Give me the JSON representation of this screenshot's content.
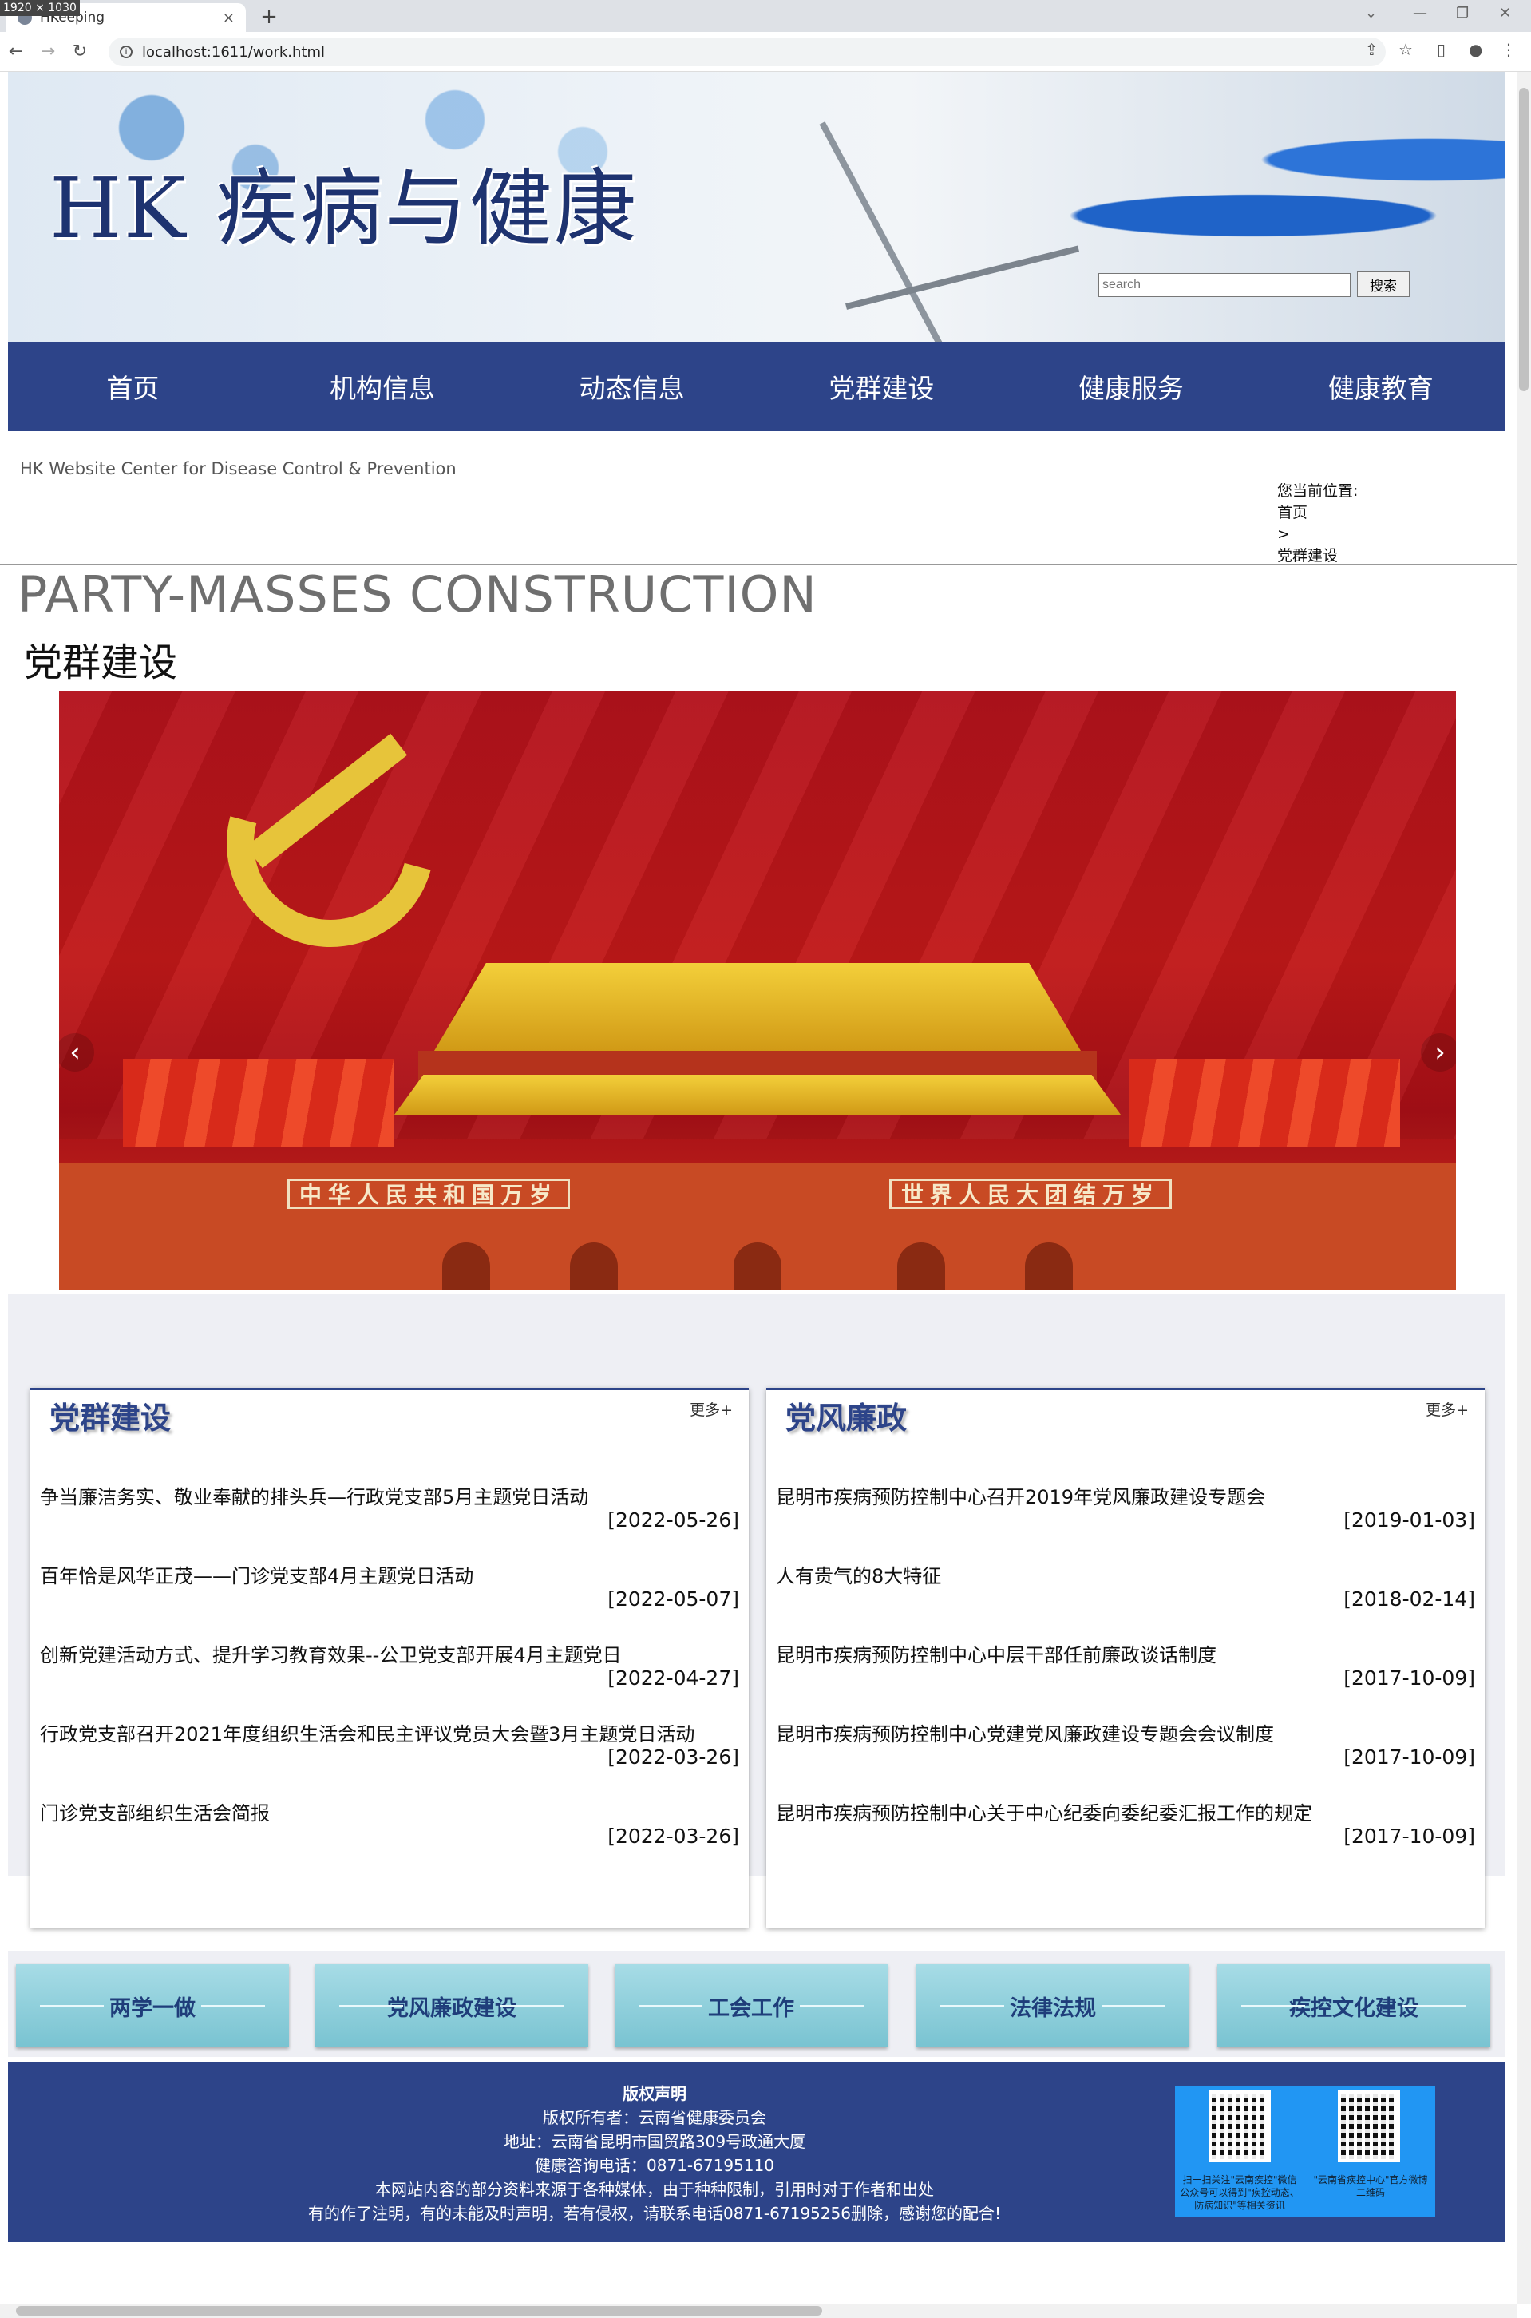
{
  "browser": {
    "dim_badge": "1920 × 1030",
    "tab_title": "HKeeping",
    "url": "localhost:1611/work.html"
  },
  "header": {
    "site_title": "HK 疾病与健康",
    "search_placeholder": "search",
    "search_button": "搜索"
  },
  "nav": [
    "首页",
    "机构信息",
    "动态信息",
    "党群建设",
    "健康服务",
    "健康教育"
  ],
  "subheader": {
    "en_center": "HK Website Center for Disease Control & Prevention",
    "breadcrumb_label": "您当前位置:",
    "breadcrumb_home": "首页",
    "breadcrumb_sep": ">",
    "breadcrumb_current": "党群建设"
  },
  "page": {
    "en_title": "PARTY-MASSES CONSTRUCTION",
    "zh_title": "党群建设"
  },
  "carousel": {
    "slogan_left": "中华人民共和国万岁",
    "slogan_right": "世界人民大团结万岁",
    "prev": "‹",
    "next": "›",
    "dots": 5,
    "active_dot": 1
  },
  "panels": [
    {
      "title": "党群建设",
      "more": "更多+",
      "items": [
        {
          "title": "争当廉洁务实、敬业奉献的排头兵—行政党支部5月主题党日活动",
          "date": "[2022-05-26]"
        },
        {
          "title": "百年恰是风华正茂——门诊党支部4月主题党日活动",
          "date": "[2022-05-07]"
        },
        {
          "title": "创新党建活动方式、提升学习教育效果--公卫党支部开展4月主题党日",
          "date": "[2022-04-27]"
        },
        {
          "title": "行政党支部召开2021年度组织生活会和民主评议党员大会暨3月主题党日活动",
          "date": "[2022-03-26]"
        },
        {
          "title": "门诊党支部组织生活会简报",
          "date": "[2022-03-26]"
        }
      ]
    },
    {
      "title": "党风廉政",
      "more": "更多+",
      "items": [
        {
          "title": "昆明市疾病预防控制中心召开2019年党风廉政建设专题会",
          "date": "[2019-01-03]"
        },
        {
          "title": "人有贵气的8大特征",
          "date": "[2018-02-14]"
        },
        {
          "title": "昆明市疾病预防控制中心中层干部任前廉政谈话制度",
          "date": "[2017-10-09]"
        },
        {
          "title": "昆明市疾病预防控制中心党建党风廉政建设专题会会议制度",
          "date": "[2017-10-09]"
        },
        {
          "title": "昆明市疾病预防控制中心关于中心纪委向委纪委汇报工作的规定",
          "date": "[2017-10-09]"
        }
      ]
    }
  ],
  "quick_links": [
    "两学一做",
    "党风廉政建设",
    "工会工作",
    "法律法规",
    "疾控文化建设"
  ],
  "footer": {
    "lines": [
      "版权声明",
      "版权所有者：云南省健康委员会",
      "地址：云南省昆明市国贸路309号政通大厦",
      "健康咨询电话：0871-67195110",
      "本网站内容的部分资料来源于各种媒体，由于种种限制，引用时对于作者和出处",
      "有的作了注明，有的未能及时声明，若有侵权，请联系电话0871-67195256删除，感谢您的配合!"
    ],
    "qr_caption_left": "扫一扫关注\"云南疾控\"微信公众号可以得到\"疾控动态、防病知识\"等相关资讯",
    "qr_caption_right": "\"云南省疾控中心\"官方微博二维码"
  }
}
